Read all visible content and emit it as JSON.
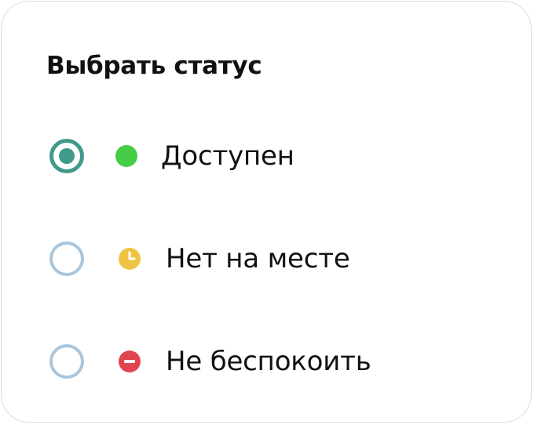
{
  "panel": {
    "title": "Выбрать статус"
  },
  "options": [
    {
      "label": "Доступен",
      "selected": true,
      "icon": "available-dot-icon",
      "icon_color": "#47cc47"
    },
    {
      "label": "Нет на месте",
      "selected": false,
      "icon": "clock-icon",
      "icon_color": "#f0c443"
    },
    {
      "label": "Не беспокоить",
      "selected": false,
      "icon": "do-not-disturb-icon",
      "icon_color": "#e0454f"
    }
  ],
  "colors": {
    "radio_selected": "#3f9a8c",
    "radio_unselected": "#a9c6dc"
  }
}
